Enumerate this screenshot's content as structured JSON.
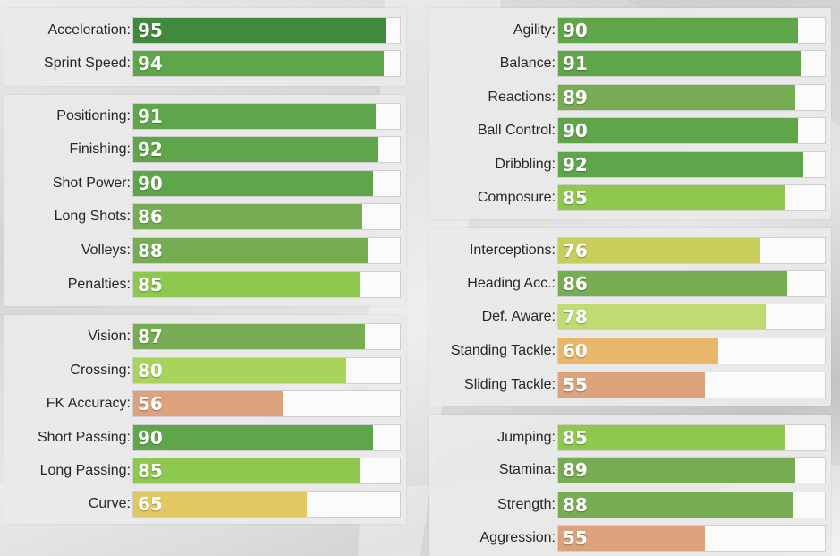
{
  "colors": {
    "elite": "#3f8a3c",
    "excellent": "#5fa64b",
    "very_good": "#76ad52",
    "good": "#8fc84f",
    "above_avg": "#a9d45c",
    "fair": "#c0db72",
    "average": "#c9cd5c",
    "mediocre": "#e3c763",
    "low_orange": "#e8b76a",
    "poor": "#dca27c"
  },
  "left_panels": [
    {
      "stats": [
        {
          "label": "Acceleration:",
          "value": "95",
          "fill_pct": 95,
          "color": "#3f8a3c"
        },
        {
          "label": "Sprint Speed:",
          "value": "94",
          "fill_pct": 94,
          "color": "#5fa64b"
        }
      ]
    },
    {
      "stats": [
        {
          "label": "Positioning:",
          "value": "91",
          "fill_pct": 91,
          "color": "#5fa64b"
        },
        {
          "label": "Finishing:",
          "value": "92",
          "fill_pct": 92,
          "color": "#5fa64b"
        },
        {
          "label": "Shot Power:",
          "value": "90",
          "fill_pct": 90,
          "color": "#5fa64b"
        },
        {
          "label": "Long Shots:",
          "value": "86",
          "fill_pct": 86,
          "color": "#76ad52"
        },
        {
          "label": "Volleys:",
          "value": "88",
          "fill_pct": 88,
          "color": "#76ad52"
        },
        {
          "label": "Penalties:",
          "value": "85",
          "fill_pct": 85,
          "color": "#8fc84f"
        }
      ]
    },
    {
      "stats": [
        {
          "label": "Vision:",
          "value": "87",
          "fill_pct": 87,
          "color": "#76ad52"
        },
        {
          "label": "Crossing:",
          "value": "80",
          "fill_pct": 80,
          "color": "#a9d45c"
        },
        {
          "label": "FK Accuracy:",
          "value": "56",
          "fill_pct": 56,
          "color": "#dca27c"
        },
        {
          "label": "Short Passing:",
          "value": "90",
          "fill_pct": 90,
          "color": "#5fa64b"
        },
        {
          "label": "Long Passing:",
          "value": "85",
          "fill_pct": 85,
          "color": "#8fc84f"
        },
        {
          "label": "Curve:",
          "value": "65",
          "fill_pct": 65,
          "color": "#e3c763"
        }
      ]
    }
  ],
  "right_panels": [
    {
      "stats": [
        {
          "label": "Agility:",
          "value": "90",
          "fill_pct": 90,
          "color": "#5fa64b"
        },
        {
          "label": "Balance:",
          "value": "91",
          "fill_pct": 91,
          "color": "#5fa64b"
        },
        {
          "label": "Reactions:",
          "value": "89",
          "fill_pct": 89,
          "color": "#76ad52"
        },
        {
          "label": "Ball Control:",
          "value": "90",
          "fill_pct": 90,
          "color": "#5fa64b"
        },
        {
          "label": "Dribbling:",
          "value": "92",
          "fill_pct": 92,
          "color": "#5fa64b"
        },
        {
          "label": "Composure:",
          "value": "85",
          "fill_pct": 85,
          "color": "#8fc84f"
        }
      ]
    },
    {
      "stats": [
        {
          "label": "Interceptions:",
          "value": "76",
          "fill_pct": 76,
          "color": "#c9cd5c"
        },
        {
          "label": "Heading Acc.:",
          "value": "86",
          "fill_pct": 86,
          "color": "#76ad52"
        },
        {
          "label": "Def. Aware:",
          "value": "78",
          "fill_pct": 78,
          "color": "#c0db72"
        },
        {
          "label": "Standing Tackle:",
          "value": "60",
          "fill_pct": 60,
          "color": "#e8b76a"
        },
        {
          "label": "Sliding Tackle:",
          "value": "55",
          "fill_pct": 55,
          "color": "#dca27c"
        }
      ]
    },
    {
      "stats": [
        {
          "label": "Jumping:",
          "value": "85",
          "fill_pct": 85,
          "color": "#8fc84f"
        },
        {
          "label": "Stamina:",
          "value": "89",
          "fill_pct": 89,
          "color": "#76ad52"
        },
        {
          "label": "Strength:",
          "value": "88",
          "fill_pct": 88,
          "color": "#76ad52"
        },
        {
          "label": "Aggression:",
          "value": "55",
          "fill_pct": 55,
          "color": "#dca27c"
        }
      ]
    }
  ]
}
